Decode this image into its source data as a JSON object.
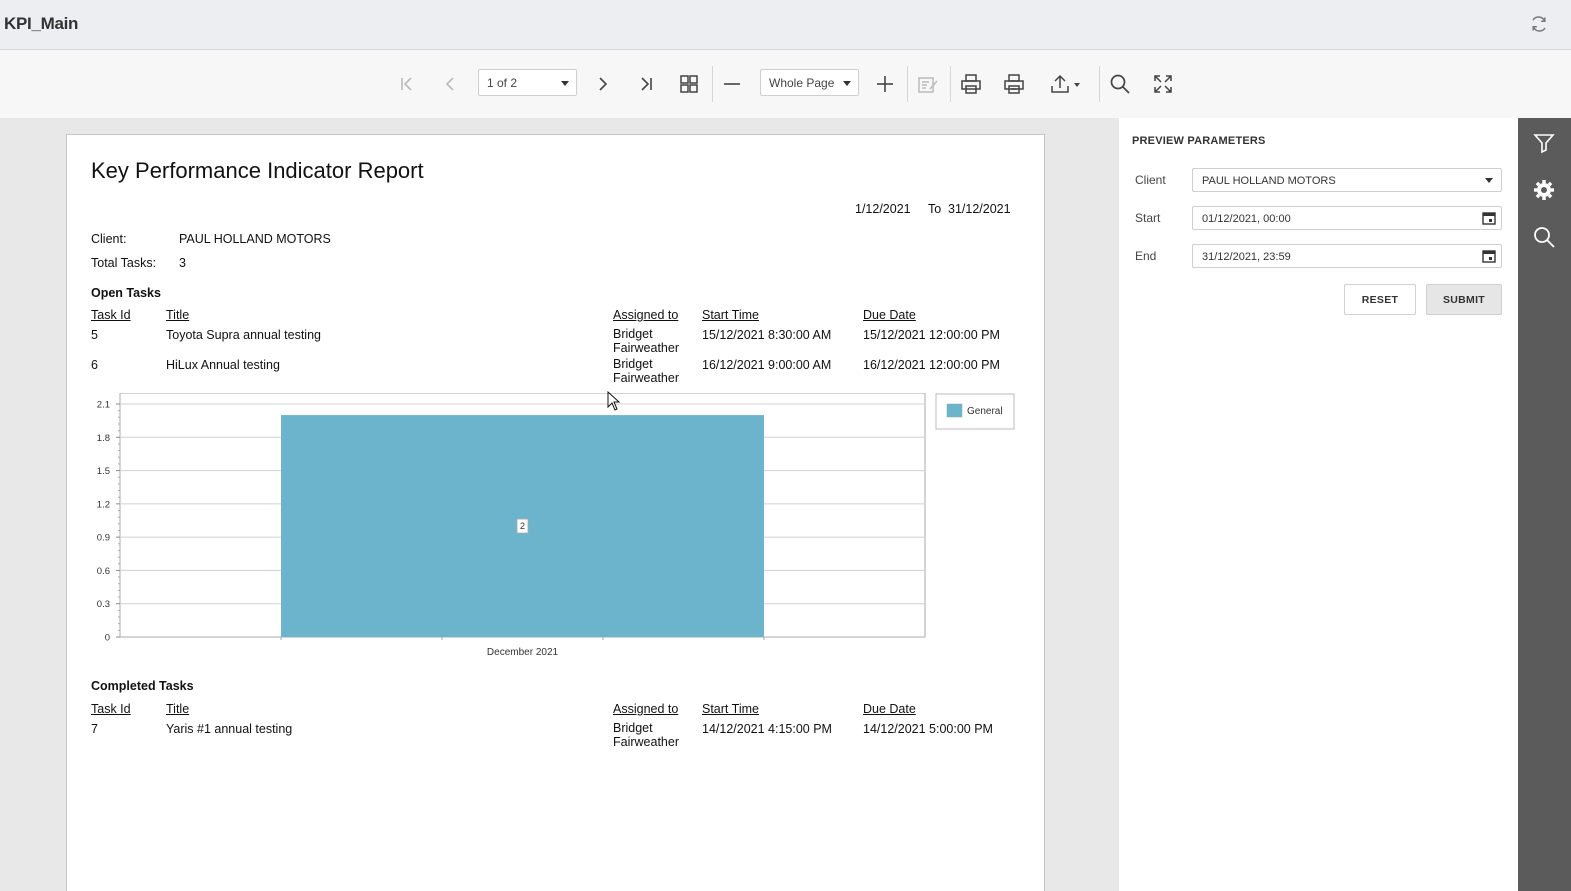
{
  "app": {
    "title": "KPI_Main"
  },
  "toolbar": {
    "page_select": "1 of 2",
    "zoom_select": "Whole Page",
    "icons": [
      "first-page-icon",
      "previous-page-icon",
      "next-page-icon",
      "last-page-icon",
      "multipage-icon",
      "zoom-out-icon",
      "zoom-in-icon",
      "edit-fields-icon",
      "print-icon",
      "print-page-icon",
      "export-icon",
      "search-icon",
      "fullscreen-icon"
    ]
  },
  "report": {
    "title": "Key Performance Indicator Report",
    "date_from": "1/12/2021",
    "to_label": "To",
    "date_to": "31/12/2021",
    "client_label": "Client:",
    "client_value": "PAUL HOLLAND MOTORS",
    "total_label": "Total Tasks:",
    "total_value": "3",
    "columns": [
      "Task Id",
      "Title",
      "Assigned to",
      "Start Time",
      "Due Date"
    ],
    "open_section": "Open Tasks",
    "open_tasks": [
      {
        "id": "5",
        "title": "Toyota Supra annual testing",
        "assigned": "Bridget Fairweather",
        "start": "15/12/2021 8:30:00 AM",
        "due": "15/12/2021 12:00:00 PM"
      },
      {
        "id": "6",
        "title": "HiLux Annual testing",
        "assigned": "Bridget Fairweather",
        "start": "16/12/2021 9:00:00 AM",
        "due": "16/12/2021 12:00:00 PM"
      }
    ],
    "completed_section": "Completed Tasks",
    "completed_tasks": [
      {
        "id": "7",
        "title": "Yaris #1 annual testing",
        "assigned": "Bridget Fairweather",
        "start": "14/12/2021 4:15:00 PM",
        "due": "14/12/2021 5:00:00 PM"
      }
    ]
  },
  "chart_data": {
    "type": "bar",
    "categories": [
      "December 2021"
    ],
    "series": [
      {
        "name": "General",
        "values": [
          2
        ]
      }
    ],
    "data_labels": [
      "2"
    ],
    "yticks": [
      "0",
      "0.3",
      "0.6",
      "0.9",
      "1.2",
      "1.5",
      "1.8",
      "2.1"
    ],
    "ylim": [
      0,
      2.1
    ],
    "grid": true,
    "legend": "right",
    "bar_color": "#6cb3cc"
  },
  "panel": {
    "title": "PREVIEW PARAMETERS",
    "client_label": "Client",
    "client_value": "PAUL HOLLAND MOTORS",
    "start_label": "Start",
    "start_value": "01/12/2021, 00:00",
    "end_label": "End",
    "end_value": "31/12/2021, 23:59",
    "reset_label": "RESET",
    "submit_label": "SUBMIT"
  },
  "sidebar": {
    "icons": [
      "filter-icon",
      "gear-icon",
      "search-icon"
    ]
  }
}
